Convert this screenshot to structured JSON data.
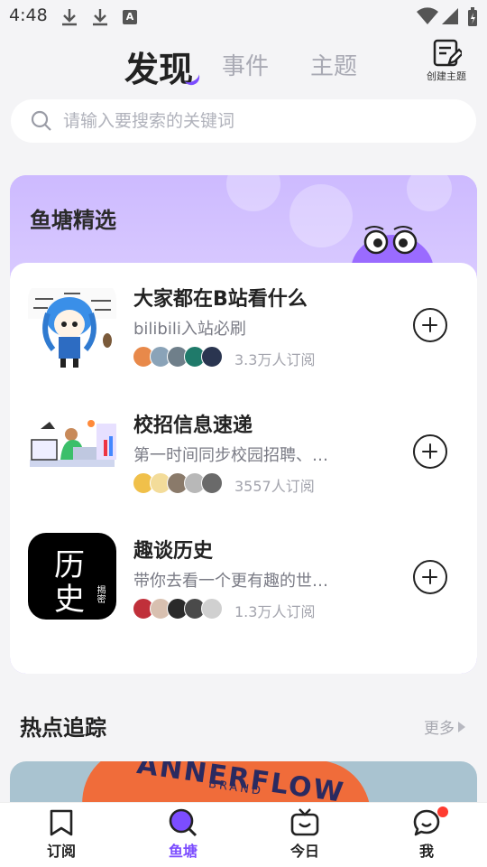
{
  "status_bar": {
    "time": "4:48",
    "icons": [
      "download-icon",
      "download-icon",
      "a-icon",
      "wifi-icon",
      "signal-icon",
      "battery-icon"
    ],
    "a_icon_letter": "A"
  },
  "header": {
    "tabs": [
      {
        "label": "发现",
        "active": true
      },
      {
        "label": "事件",
        "active": false
      },
      {
        "label": "主题",
        "active": false
      }
    ],
    "create_topic_label": "创建主题"
  },
  "search": {
    "placeholder": "请输入要搜索的关键词"
  },
  "featured": {
    "title": "鱼塘精选",
    "items": [
      {
        "name": "大家都在B站看什么",
        "description": "bilibili入站必刷",
        "subscribers": "3.3万人订阅",
        "thumb": "anime-girl"
      },
      {
        "name": "校招信息速递",
        "description": "第一时间同步校园招聘、…",
        "subscribers": "3557人订阅",
        "thumb": "office-illustration"
      },
      {
        "name": "趣谈历史",
        "description": "带你去看一个更有趣的世…",
        "subscribers": "1.3万人订阅",
        "thumb": "history-logo"
      }
    ],
    "history_logo": {
      "line1": "历",
      "line2": "史",
      "seal": "揭密"
    }
  },
  "hot": {
    "title": "热点追踪",
    "more_label": "更多",
    "banner_text": "ANNERFLOW",
    "banner_subtext": "BRAND"
  },
  "bottom_nav": {
    "items": [
      {
        "label": "订阅",
        "icon": "bookmark-icon",
        "active": false
      },
      {
        "label": "鱼塘",
        "icon": "search-icon",
        "active": true
      },
      {
        "label": "今日",
        "icon": "tv-icon",
        "active": false
      },
      {
        "label": "我",
        "icon": "chat-icon",
        "active": false,
        "badge": true
      }
    ]
  },
  "colors": {
    "accent": "#7c4dff",
    "banner_purple": "#c9b6ff",
    "badge": "#ff3b30"
  }
}
